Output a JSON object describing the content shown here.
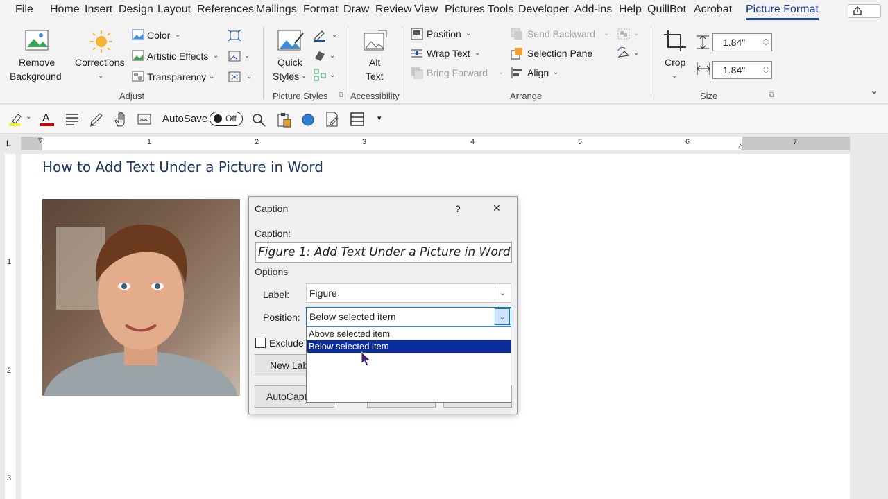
{
  "menu": {
    "tabs": [
      "File",
      "Home",
      "Insert",
      "Design",
      "Layout",
      "References",
      "Mailings",
      "Format",
      "Draw",
      "Review",
      "View",
      "Pictures Tools",
      "Developer",
      "Add-ins",
      "Help",
      "QuillBot",
      "Acrobat",
      "Picture Format"
    ],
    "active_tab": "Picture Format"
  },
  "ribbon": {
    "remove_bg": [
      "Remove",
      "Background"
    ],
    "corrections": "Corrections",
    "color": "Color",
    "artistic": "Artistic Effects",
    "transparency": "Transparency",
    "adjust": "Adjust",
    "quick_styles": [
      "Quick",
      "Styles"
    ],
    "picture_styles": "Picture Styles",
    "alt_text": [
      "Alt",
      "Text"
    ],
    "accessibility": "Accessibility",
    "position": "Position",
    "wrap_text": "Wrap Text",
    "bring_forward": "Bring Forward",
    "send_backward": "Send Backward",
    "selection_pane": "Selection Pane",
    "align": "Align",
    "arrange": "Arrange",
    "crop": "Crop",
    "height": "1.84\"",
    "width": "1.84\"",
    "size": "Size"
  },
  "qat": {
    "autosave": "AutoSave",
    "toggle": "Off"
  },
  "ruler": {
    "h": [
      "1",
      "2",
      "3",
      "4",
      "5",
      "6",
      "7"
    ],
    "v": [
      "1",
      "2",
      "3"
    ]
  },
  "document": {
    "title": "How to Add Text Under a Picture in Word"
  },
  "dialog": {
    "title": "Caption",
    "help": "?",
    "close": "✕",
    "caption_label": "Caption:",
    "caption_value": "Figure 1: Add Text Under a Picture in Word",
    "options": "Options",
    "label_label": "Label:",
    "label_value": "Figure",
    "position_label": "Position:",
    "position_value": "Below selected item",
    "exclude": "Exclude l",
    "new_label": "New Lab",
    "autocaption": "AutoCapti",
    "dropdown_options": [
      "Above selected item",
      "Below selected item"
    ]
  },
  "colors": {
    "accent": "#1a3f9c",
    "selection": "#0a2d9e",
    "title": "#1f3864"
  }
}
